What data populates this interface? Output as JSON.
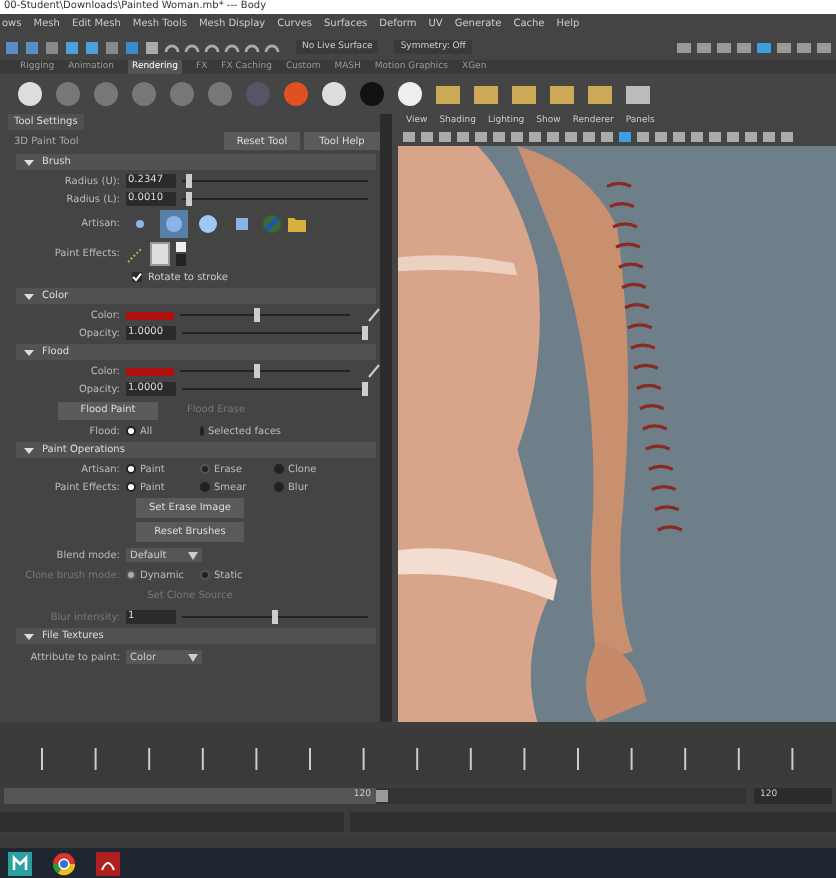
{
  "window": {
    "title": "00-Student\\Downloads\\Painted Woman.mb*  ---  Body"
  },
  "menu": [
    "ows",
    "Mesh",
    "Edit Mesh",
    "Mesh Tools",
    "Mesh Display",
    "Curves",
    "Surfaces",
    "Deform",
    "UV",
    "Generate",
    "Cache",
    "Help"
  ],
  "status_line": {
    "live_surface": "No Live Surface",
    "symmetry": "Symmetry: Off"
  },
  "shelf": {
    "tabs": [
      {
        "label": "Rigging",
        "selected": false
      },
      {
        "label": "Animation",
        "selected": false
      },
      {
        "label": "Rendering",
        "selected": true
      },
      {
        "label": "FX",
        "selected": false
      },
      {
        "label": "FX Caching",
        "selected": false
      },
      {
        "label": "Custom",
        "selected": false
      },
      {
        "label": "MASH",
        "selected": false
      },
      {
        "label": "Motion Graphics",
        "selected": false
      },
      {
        "label": "XGen",
        "selected": false
      }
    ]
  },
  "tool_settings": {
    "tab": "Tool Settings",
    "tool": "3D Paint Tool",
    "buttons": [
      "Reset Tool",
      "Tool Help"
    ],
    "sections": [
      {
        "title": "Brush",
        "expanded": true,
        "rows": [
          {
            "kind": "field_slider",
            "label": "Radius (U):",
            "value": "0.2347",
            "level": 0.02
          },
          {
            "kind": "field_slider",
            "label": "Radius (L):",
            "value": "0.0010",
            "level": 0.02
          },
          {
            "kind": "icons",
            "label": "Artisan:",
            "icons": [
              {
                "selected": false
              },
              {
                "selected": true
              },
              {
                "selected": false
              },
              {
                "selected": false
              }
            ]
          },
          {
            "kind": "effects",
            "label": "Paint Effects:"
          },
          {
            "kind": "checkbox",
            "label": "Rotate to stroke",
            "checked": true
          }
        ]
      },
      {
        "title": "Color",
        "expanded": true,
        "rows": [
          {
            "kind": "color_slider",
            "label": "Color:",
            "color": "#b01010",
            "level": 0.45
          },
          {
            "kind": "field_slider",
            "label": "Opacity:",
            "value": "1.0000",
            "level": 1
          }
        ]
      },
      {
        "title": "Flood",
        "expanded": true,
        "rows": [
          {
            "kind": "color_slider",
            "label": "Color:",
            "color": "#b01010",
            "level": 0.45
          },
          {
            "kind": "field_slider",
            "label": "Opacity:",
            "value": "1.0000",
            "level": 1
          },
          {
            "kind": "buttons",
            "buttons": [
              {
                "label": "Flood Paint",
                "disabled": false
              },
              {
                "label": "Flood Erase",
                "disabled": true
              }
            ]
          },
          {
            "kind": "radios",
            "label": "Flood:",
            "options": [
              {
                "label": "All",
                "selected": true,
                "disabled": false
              },
              {
                "label": "Selected faces",
                "selected": false,
                "disabled": false
              }
            ]
          }
        ]
      },
      {
        "title": "Paint Operations",
        "expanded": true,
        "rows": [
          {
            "kind": "radios",
            "label": "Artisan:",
            "options": [
              {
                "label": "Paint",
                "selected": true,
                "disabled": false
              },
              {
                "label": "Erase",
                "selected": false,
                "disabled": true
              },
              {
                "label": "Clone",
                "selected": false,
                "disabled": false
              }
            ]
          },
          {
            "kind": "radios",
            "label": "Paint Effects:",
            "options": [
              {
                "label": "Paint",
                "selected": true,
                "disabled": false
              },
              {
                "label": "Smear",
                "selected": false,
                "disabled": false
              },
              {
                "label": "Blur",
                "selected": false,
                "disabled": false
              }
            ]
          },
          {
            "kind": "button",
            "label": "Set Erase Image",
            "disabled": false
          },
          {
            "kind": "button",
            "label": "Reset Brushes",
            "disabled": false
          },
          {
            "kind": "dropdown",
            "label": "Blend mode:",
            "value": "Default"
          },
          {
            "kind": "radios",
            "label": "Clone brush mode:",
            "disabled": true,
            "options": [
              {
                "label": "Dynamic",
                "selected": true,
                "disabled": true
              },
              {
                "label": "Static",
                "selected": false,
                "disabled": true
              }
            ]
          },
          {
            "kind": "button",
            "label": "Set Clone Source",
            "disabled": true
          },
          {
            "kind": "field_slider",
            "label": "Blur intensity:",
            "value": "1",
            "level": 0.5,
            "disabled": true
          }
        ]
      },
      {
        "title": "File Textures",
        "expanded": true,
        "rows": [
          {
            "kind": "dropdown",
            "label": "Attribute to paint:",
            "value": "Color"
          }
        ]
      }
    ]
  },
  "viewport": {
    "menu": [
      "View",
      "Shading",
      "Lighting",
      "Show",
      "Renderer",
      "Panels"
    ]
  },
  "time_slider": {
    "range": {
      "label": "120",
      "level": 0.5
    },
    "end_field": "120"
  }
}
